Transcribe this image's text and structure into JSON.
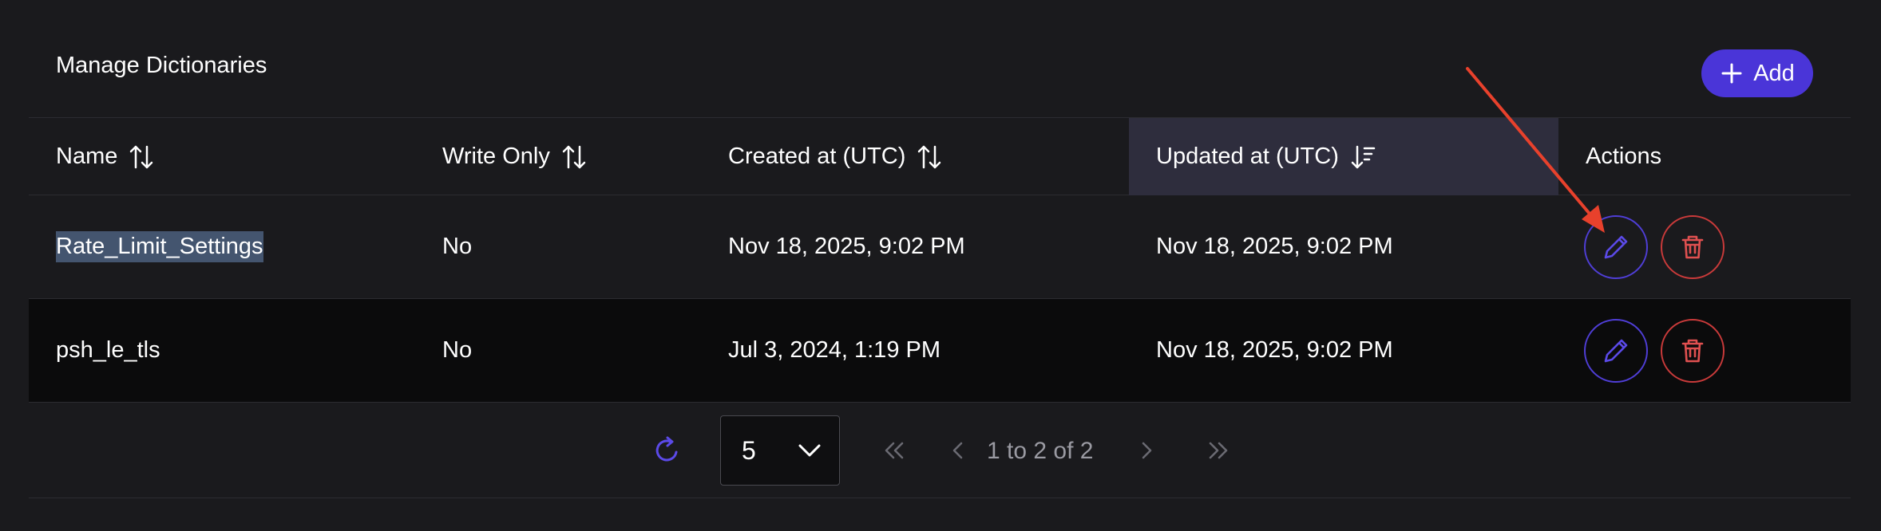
{
  "header": {
    "title": "Manage Dictionaries",
    "add_label": "Add"
  },
  "columns": [
    {
      "label": "Name",
      "sort": "none"
    },
    {
      "label": "Write Only",
      "sort": "none"
    },
    {
      "label": "Created at (UTC)",
      "sort": "none"
    },
    {
      "label": "Updated at (UTC)",
      "sort": "desc"
    },
    {
      "label": "Actions"
    }
  ],
  "rows": [
    {
      "name": "Rate_Limit_Settings",
      "write_only": "No",
      "created_at": "Nov 18, 2025, 9:02 PM",
      "updated_at": "Nov 18, 2025, 9:02 PM"
    },
    {
      "name": "psh_le_tls",
      "write_only": "No",
      "created_at": "Jul 3, 2024, 1:19 PM",
      "updated_at": "Nov 18, 2025, 9:02 PM"
    }
  ],
  "pagination": {
    "page_size": "5",
    "range_text": "1 to 2 of 2"
  },
  "colors": {
    "accent": "#4a35d8",
    "danger": "#c93a3a",
    "annotation_arrow": "#e8412c"
  }
}
